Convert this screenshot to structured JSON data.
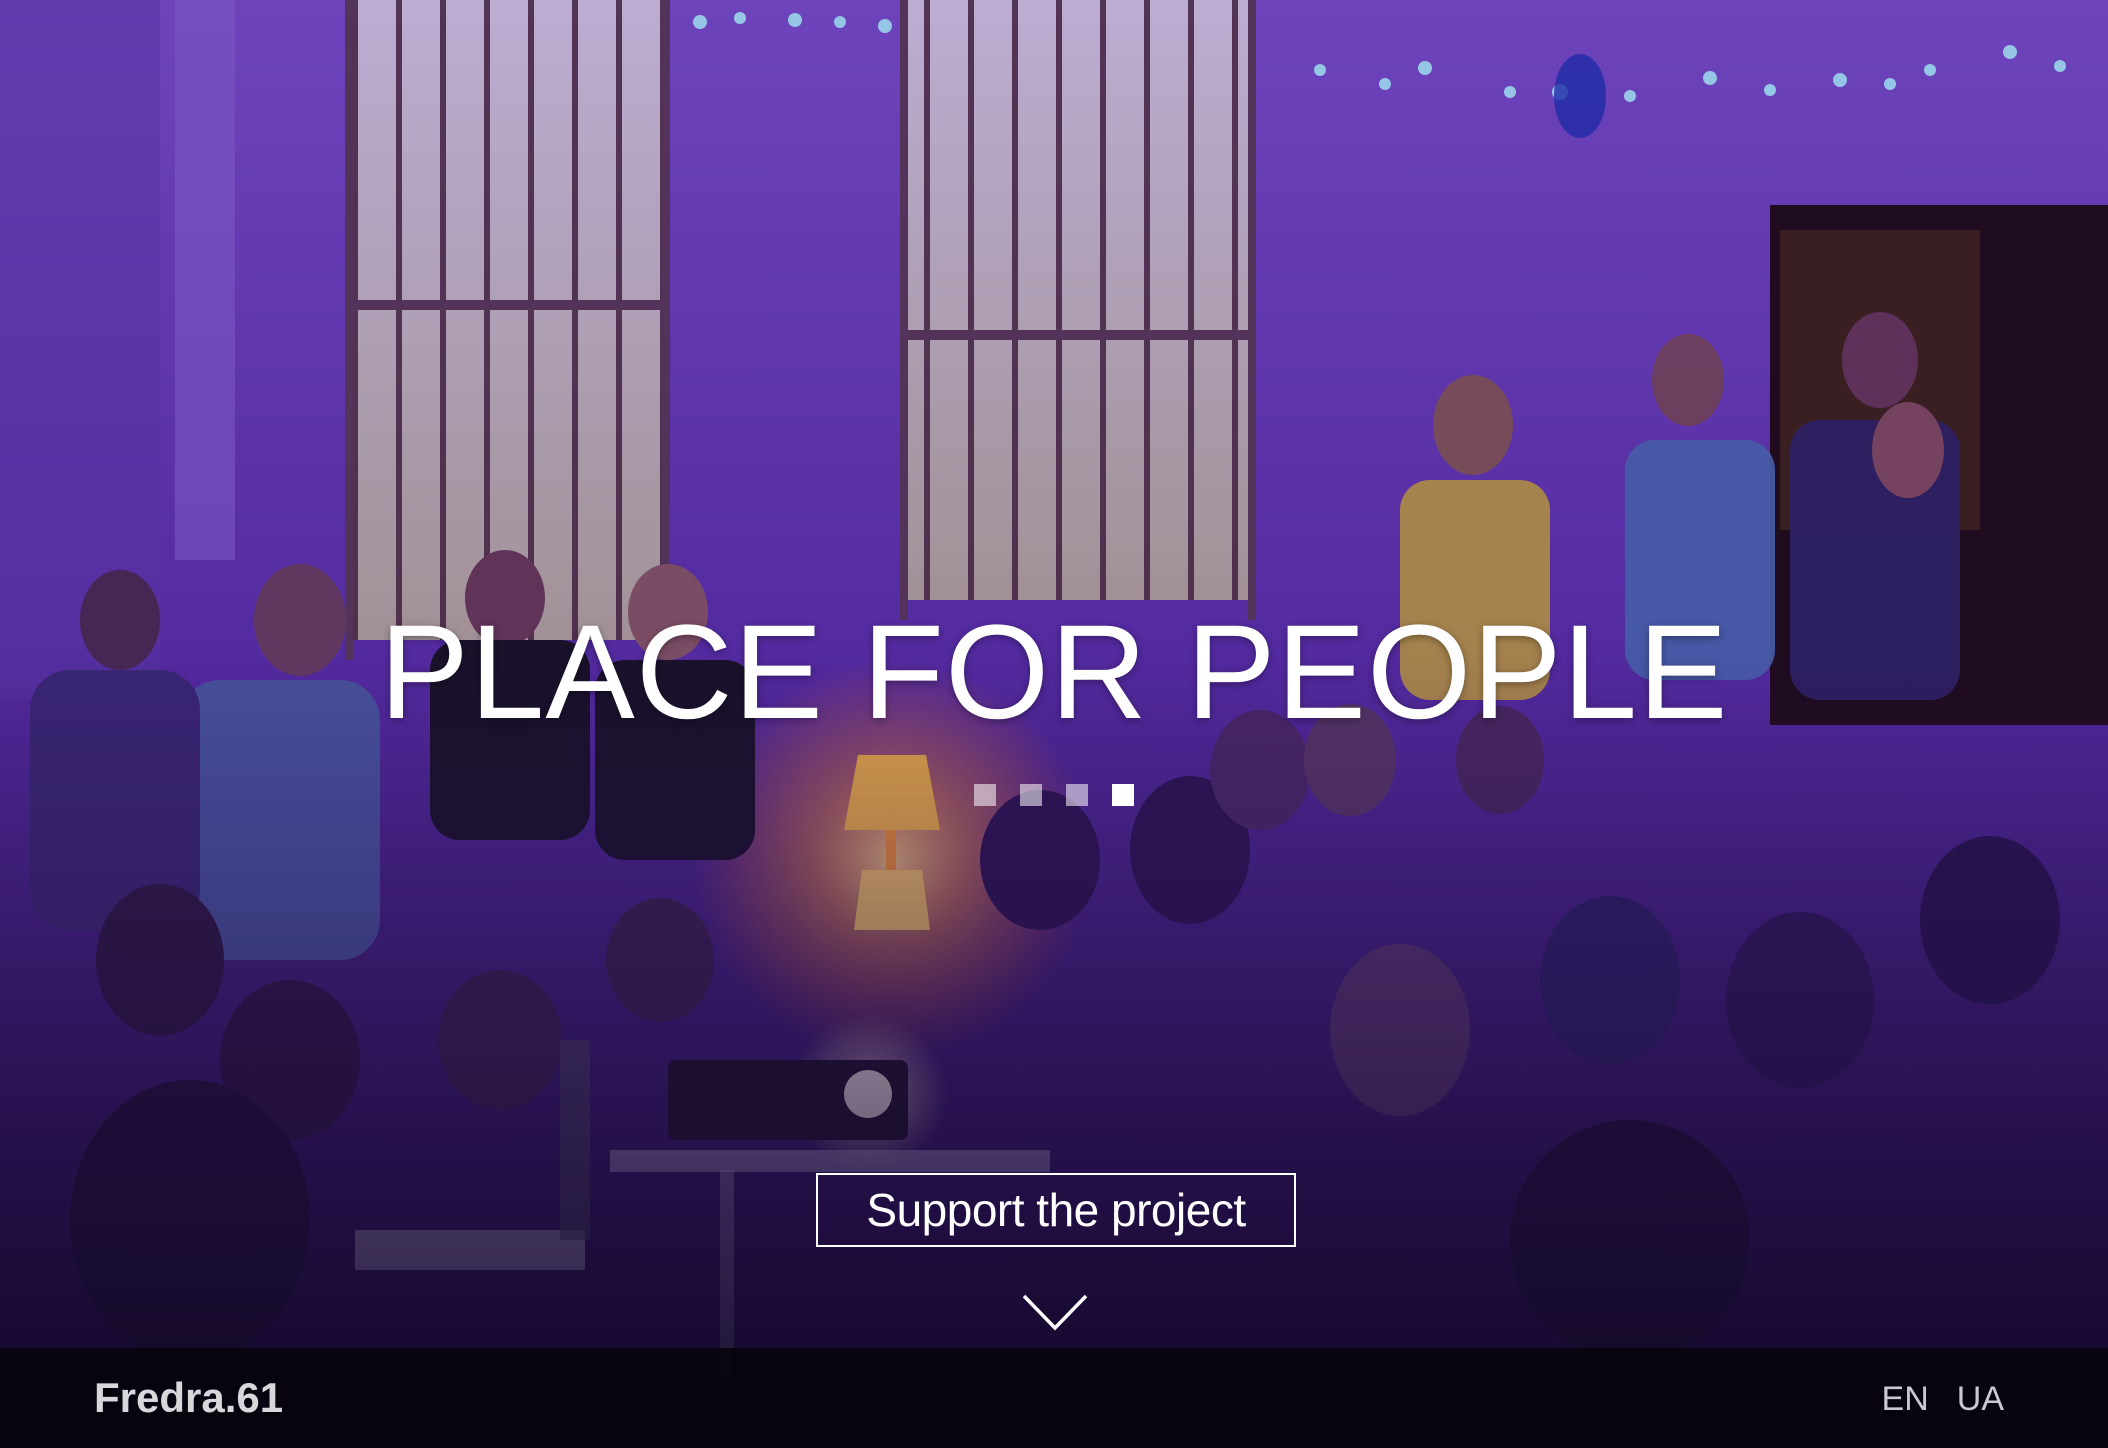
{
  "hero": {
    "title": "PLACE FOR PEOPLE",
    "slides": [
      {
        "active": false
      },
      {
        "active": false
      },
      {
        "active": false
      },
      {
        "active": true
      }
    ],
    "support_label": "Support the project",
    "scroll_icon": "chevron-down-icon"
  },
  "footer": {
    "brand": "Fredra.61",
    "languages": [
      "EN",
      "UA"
    ]
  },
  "colors": {
    "overlay": "#2a0f5c",
    "accent_white": "#ffffff",
    "bar_bg": "#06040a",
    "lamp_glow": "#ffb23a"
  }
}
